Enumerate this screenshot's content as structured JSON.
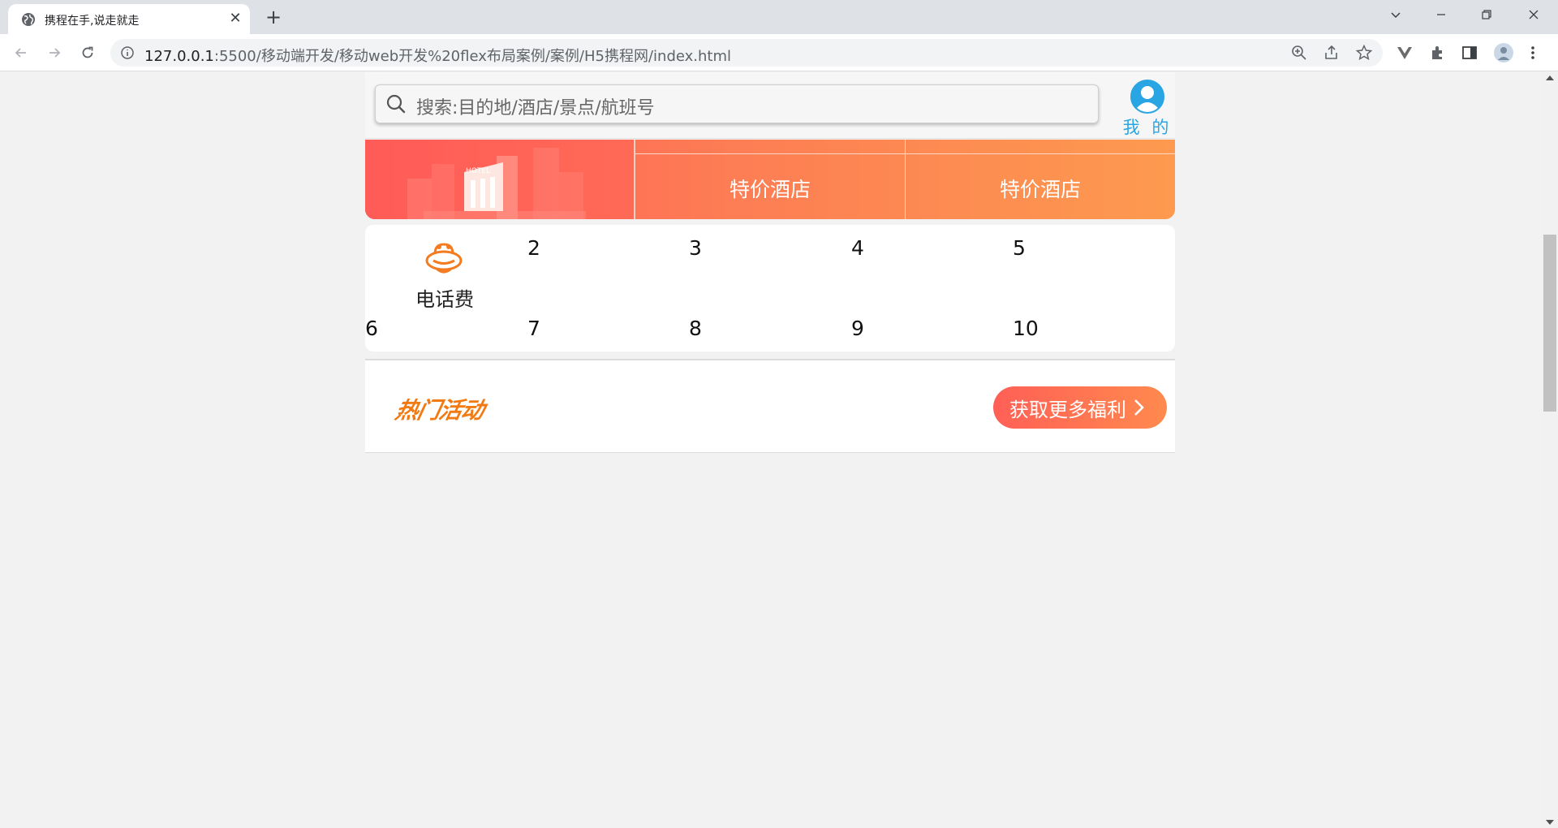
{
  "browser": {
    "tab_title": "携程在手,说走就走",
    "tab_close": "✕",
    "new_tab": "+",
    "url_host": "127.0.0.1",
    "url_path": ":5500/移动端开发/移动web开发%20flex布局案例/案例/H5携程网/index.html"
  },
  "header": {
    "search_placeholder": "搜索:目的地/酒店/景点/航班号",
    "user_label": "我 的"
  },
  "hotel": {
    "banner_text": "HOTEL",
    "columns": [
      "特价酒店",
      "特价酒店"
    ]
  },
  "nav_grid": {
    "first_label": "电话费",
    "items": [
      "2",
      "3",
      "4",
      "5",
      "6",
      "7",
      "8",
      "9",
      "10"
    ]
  },
  "hot_activity": {
    "title": "热门活动",
    "more_button": "获取更多福利"
  },
  "colors": {
    "accent_blue": "#2aa5e3",
    "banner_start": "#ff5b58",
    "banner_end": "#fd9a4f",
    "hot_title": "#f27a12"
  }
}
